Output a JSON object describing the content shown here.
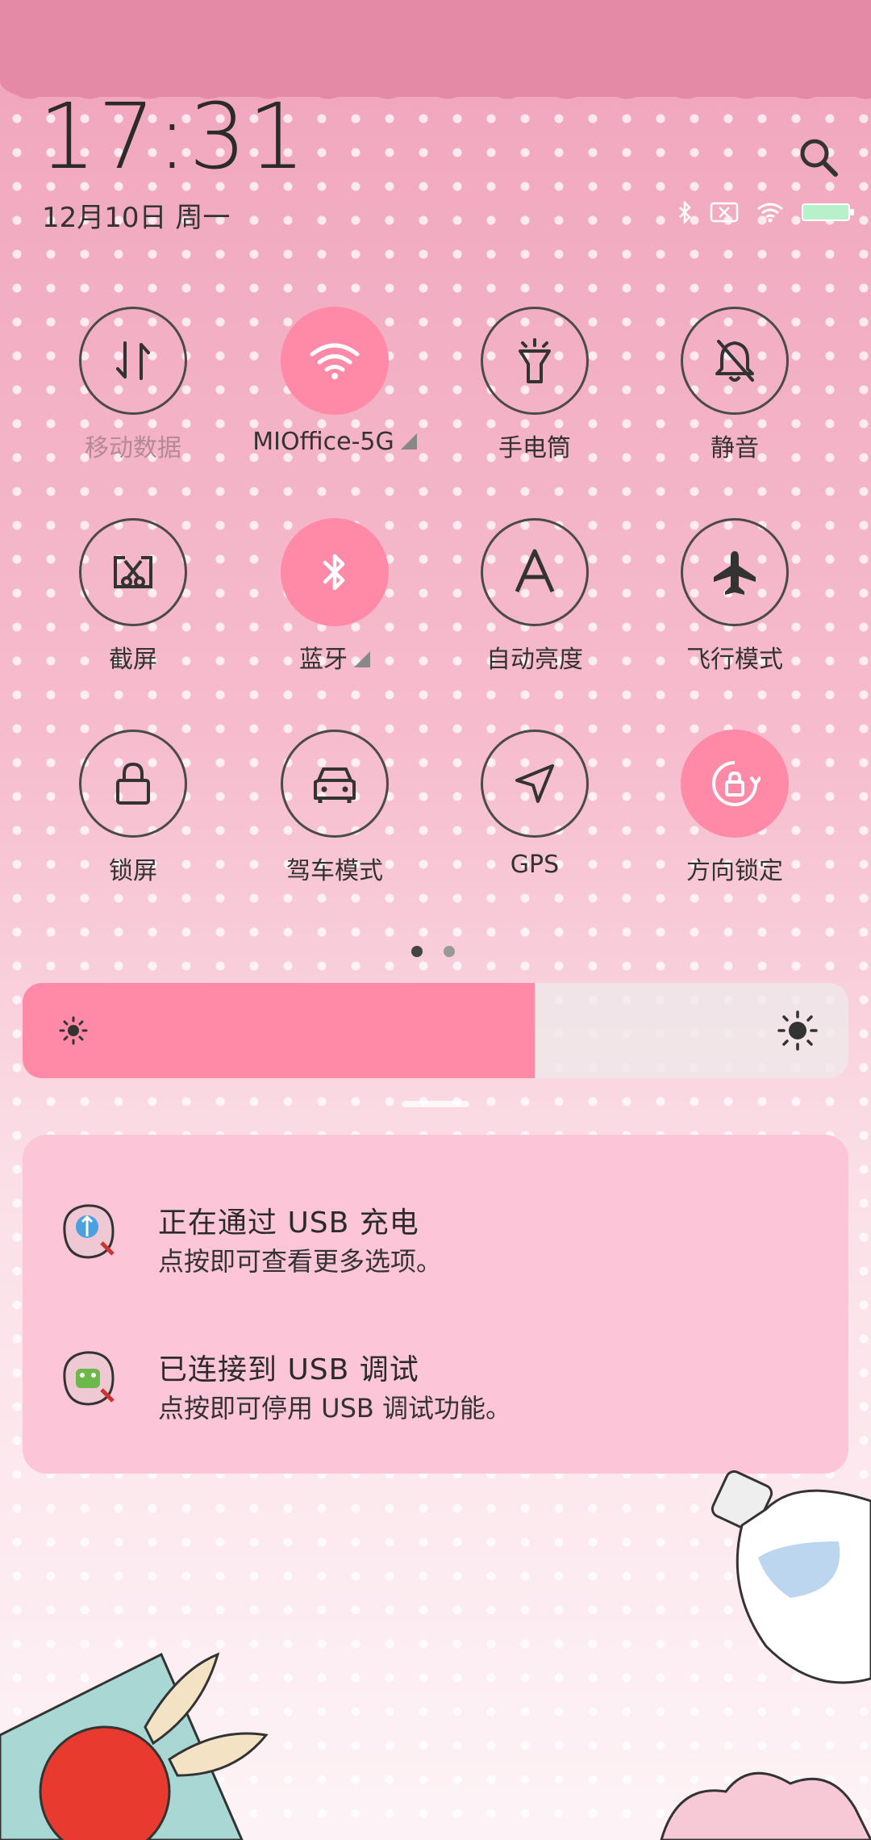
{
  "clock": {
    "time": "17:31",
    "date": "12月10日 周一"
  },
  "status_icons": [
    "bluetooth-icon",
    "no-sim-icon",
    "wifi-icon",
    "battery-icon"
  ],
  "colors": {
    "accent": "#ff8aa8",
    "card": "#fdc5d8",
    "lace": "#e48aa6"
  },
  "tiles": [
    {
      "label": "移动数据",
      "icon": "mobile-data-icon",
      "active": false,
      "dim": true
    },
    {
      "label": "MIOffice-5G",
      "icon": "wifi-icon",
      "active": true,
      "expand": true
    },
    {
      "label": "手电筒",
      "icon": "flashlight-icon",
      "active": false
    },
    {
      "label": "静音",
      "icon": "mute-icon",
      "active": false
    },
    {
      "label": "截屏",
      "icon": "screenshot-icon",
      "active": false
    },
    {
      "label": "蓝牙",
      "icon": "bluetooth-icon",
      "active": true,
      "expand": true
    },
    {
      "label": "自动亮度",
      "icon": "auto-brightness-icon",
      "active": false
    },
    {
      "label": "飞行模式",
      "icon": "airplane-icon",
      "active": false
    },
    {
      "label": "锁屏",
      "icon": "lock-icon",
      "active": false
    },
    {
      "label": "驾车模式",
      "icon": "car-icon",
      "active": false
    },
    {
      "label": "GPS",
      "icon": "gps-icon",
      "active": false
    },
    {
      "label": "方向锁定",
      "icon": "rotation-lock-icon",
      "active": true
    }
  ],
  "page_indicator": {
    "current": 1,
    "total": 2
  },
  "brightness": {
    "level": 0.62
  },
  "notifications": [
    {
      "title": "正在通过 USB 充电",
      "subtitle": "点按即可查看更多选项。",
      "icon": "usb-charging-app-icon"
    },
    {
      "title": "已连接到 USB 调试",
      "subtitle": "点按即可停用 USB 调试功能。",
      "icon": "android-debug-app-icon"
    }
  ]
}
